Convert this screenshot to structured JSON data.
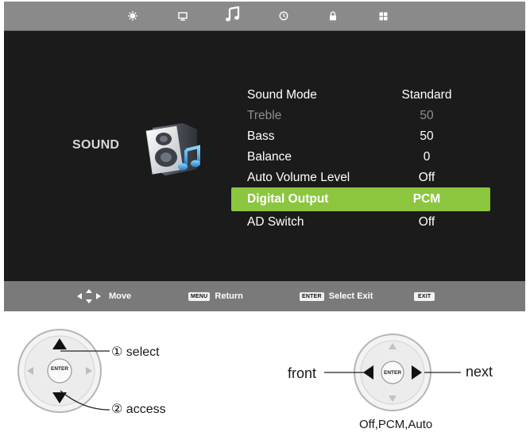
{
  "top_tabs": [
    {
      "id": "picture",
      "icon": "sun-icon",
      "active": false
    },
    {
      "id": "screen",
      "icon": "monitor-icon",
      "active": false
    },
    {
      "id": "sound",
      "icon": "music-note-icon",
      "active": true
    },
    {
      "id": "time",
      "icon": "clock-icon",
      "active": false
    },
    {
      "id": "lock",
      "icon": "lock-icon",
      "active": false
    },
    {
      "id": "setup",
      "icon": "grid-icon",
      "active": false
    }
  ],
  "section": {
    "title": "SOUND",
    "icon": "speaker-icon"
  },
  "menu": [
    {
      "label": "Sound Mode",
      "value": "Standard",
      "state": "normal"
    },
    {
      "label": "Treble",
      "value": "50",
      "state": "disabled"
    },
    {
      "label": "Bass",
      "value": "50",
      "state": "normal"
    },
    {
      "label": "Balance",
      "value": "0",
      "state": "normal"
    },
    {
      "label": "Auto Volume Level",
      "value": "Off",
      "state": "normal"
    },
    {
      "label": "Digital Output",
      "value": "PCM",
      "state": "selected"
    },
    {
      "label": "AD  Switch",
      "value": "Off",
      "state": "normal"
    }
  ],
  "bottom_hints": {
    "move": "Move",
    "menu_key": "MENU",
    "return": "Return",
    "enter_key": "ENTER",
    "select_exit": "Select Exit",
    "exit_key": "EXIT"
  },
  "remote_left": {
    "enter": "ENTER",
    "select": "① select",
    "access": "② access"
  },
  "remote_right": {
    "enter": "ENTER",
    "front": "front",
    "next": "next",
    "options": "Off,PCM,Auto"
  },
  "colors": {
    "highlight": "#8cc63f",
    "osd_bg": "#1b1b1b",
    "bar_bg": "#7a7a7a"
  }
}
